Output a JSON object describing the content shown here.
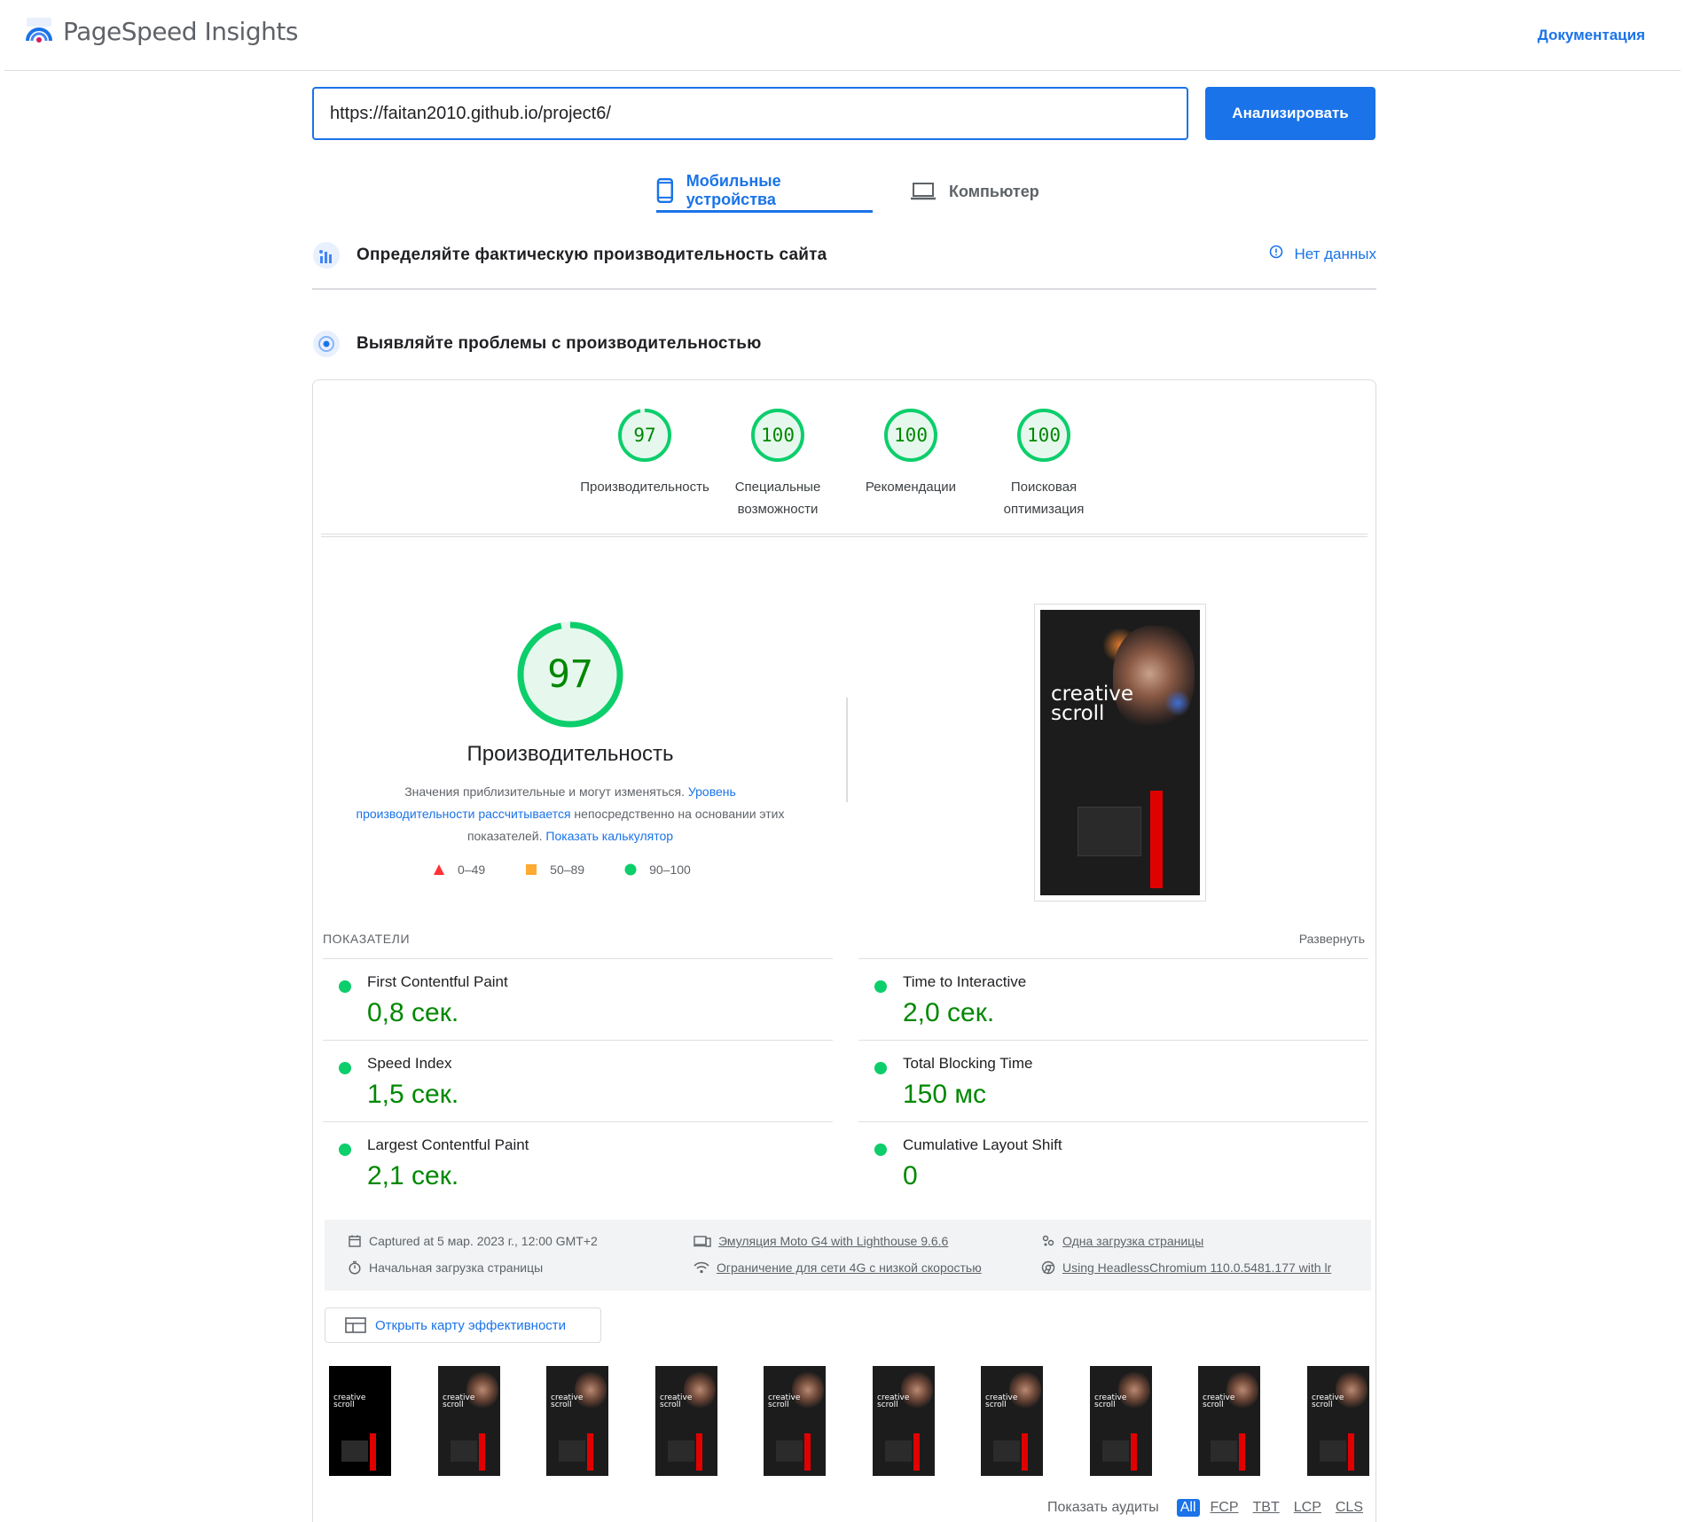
{
  "header": {
    "app_name": "PageSpeed Insights",
    "docs_link": "Документация"
  },
  "search": {
    "url_value": "https://faitan2010.github.io/project6/",
    "analyze_label": "Анализировать"
  },
  "tabs": [
    {
      "label": "Мобильные устройства",
      "active": true,
      "icon": "smartphone-icon"
    },
    {
      "label": "Компьютер",
      "active": false,
      "icon": "laptop-icon"
    }
  ],
  "field_section": {
    "title": "Определяйте фактическую производительность сайта",
    "status": "Нет данных"
  },
  "lab_section": {
    "title": "Выявляйте проблемы с производительностью"
  },
  "scores": [
    {
      "value": 97,
      "label_line1": "Производительность",
      "label_line2": ""
    },
    {
      "value": 100,
      "label_line1": "Специальные",
      "label_line2": "возможности"
    },
    {
      "value": 100,
      "label_line1": "Рекомендации",
      "label_line2": ""
    },
    {
      "value": 100,
      "label_line1": "Поисковая",
      "label_line2": "оптимизация"
    }
  ],
  "performance": {
    "score": 97,
    "title": "Производительность",
    "desc_part1": "Значения приблизительные и могут изменяться. ",
    "desc_link1": "Уровень производительности рассчитывается",
    "desc_part2": " непосредственно на основании этих показателей. ",
    "desc_link2": "Показать калькулятор",
    "legend": [
      {
        "range": "0–49",
        "color": "#ff3333",
        "shape": "triangle"
      },
      {
        "range": "50–89",
        "color": "#ffaa33",
        "shape": "square"
      },
      {
        "range": "90–100",
        "color": "#0cce6b",
        "shape": "circle"
      }
    ]
  },
  "screenshot": {
    "text_line1": "creative",
    "text_line2": "scroll"
  },
  "metrics": {
    "heading": "ПОКАЗАТЕЛИ",
    "expand_label": "Развернуть",
    "items": [
      {
        "name": "First Contentful Paint",
        "value": "0,8 сек."
      },
      {
        "name": "Time to Interactive",
        "value": "2,0 сек."
      },
      {
        "name": "Speed Index",
        "value": "1,5 сек."
      },
      {
        "name": "Total Blocking Time",
        "value": "150 мс"
      },
      {
        "name": "Largest Contentful Paint",
        "value": "2,1 сек."
      },
      {
        "name": "Cumulative Layout Shift",
        "value": "0"
      }
    ]
  },
  "runtime_info": {
    "captured": "Captured at 5 мар. 2023 г., 12:00 GMT+2",
    "initial_load": "Начальная загрузка страницы",
    "emulation": "Эмуляция Moto G4 with Lighthouse 9.6.6",
    "throttling": "Ограничение для сети 4G с низкой скоростью",
    "single_load": "Одна загрузка страницы",
    "browser": "Using HeadlessChromium 110.0.5481.177 with lr"
  },
  "treemap_label": "Открыть карту эффективности",
  "filmstrip": {
    "frame_text_line1": "creative",
    "frame_text_line2": "scroll",
    "frame_count": 10
  },
  "audits_filter": {
    "label": "Показать аудиты",
    "chips": [
      "All",
      "FCP",
      "TBT",
      "LCP",
      "CLS"
    ],
    "active": "All"
  },
  "colors": {
    "accent": "#1a73e8",
    "pass": "#0cce6b",
    "pass_text": "#008800"
  }
}
